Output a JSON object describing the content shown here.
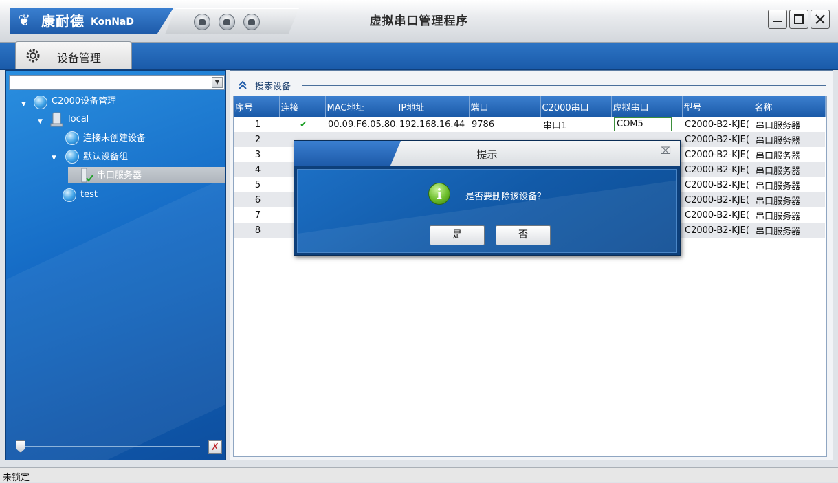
{
  "window": {
    "title": "虚拟串口管理程序",
    "logo_mark": "❦",
    "logo_cn": "康耐德",
    "logo_en": "KonNaD"
  },
  "tabs": [
    {
      "label": "设备管理",
      "icon": "gear-icon"
    }
  ],
  "sidebar": {
    "combo_value": "",
    "tree": [
      {
        "label": "C2000设备管理",
        "icon": "globe-icon",
        "expanded": true
      },
      {
        "label": "local",
        "icon": "server-icon",
        "expanded": true
      },
      {
        "label": "连接未创建设备",
        "icon": "globe-icon"
      },
      {
        "label": "默认设备组",
        "icon": "globe-icon",
        "expanded": true
      },
      {
        "label": "串口服务器",
        "icon": "device-check-icon",
        "selected": true
      },
      {
        "label": "test",
        "icon": "globe-icon"
      }
    ]
  },
  "search": {
    "label": "搜索设备"
  },
  "table": {
    "columns": [
      "序号",
      "连接",
      "MAC地址",
      "IP地址",
      "端口",
      "C2000串口",
      "虚拟串口",
      "型号",
      "名称"
    ],
    "rows": [
      {
        "no": "1",
        "conn": "✔",
        "mac": "00.09.F6.05.80.",
        "ip": "192.168.16.44",
        "port": "9786",
        "c2000": "串口1",
        "vport": "COM5",
        "model": "C2000-B2-KJE(",
        "name": "串口服务器"
      },
      {
        "no": "2",
        "conn": "",
        "mac": "",
        "ip": "",
        "port": "",
        "c2000": "",
        "vport": "",
        "model": "C2000-B2-KJE(",
        "name": "串口服务器"
      },
      {
        "no": "3",
        "conn": "",
        "mac": "",
        "ip": "",
        "port": "",
        "c2000": "",
        "vport": "",
        "model": "C2000-B2-KJE(",
        "name": "串口服务器"
      },
      {
        "no": "4",
        "conn": "",
        "mac": "",
        "ip": "",
        "port": "",
        "c2000": "",
        "vport": "",
        "model": "C2000-B2-KJE(",
        "name": "串口服务器"
      },
      {
        "no": "5",
        "conn": "",
        "mac": "",
        "ip": "",
        "port": "",
        "c2000": "",
        "vport": "",
        "model": "C2000-B2-KJE(",
        "name": "串口服务器"
      },
      {
        "no": "6",
        "conn": "",
        "mac": "",
        "ip": "",
        "port": "",
        "c2000": "",
        "vport": "",
        "model": "C2000-B2-KJE(",
        "name": "串口服务器"
      },
      {
        "no": "7",
        "conn": "",
        "mac": "",
        "ip": "",
        "port": "",
        "c2000": "",
        "vport": "",
        "model": "C2000-B2-KJE(",
        "name": "串口服务器"
      },
      {
        "no": "8",
        "conn": "",
        "mac": "",
        "ip": "",
        "port": "",
        "c2000": "",
        "vport": "",
        "model": "C2000-B2-KJE(",
        "name": "串口服务器"
      }
    ]
  },
  "dialog": {
    "title": "提示",
    "message": "是否要删除该设备？",
    "yes_label": "是",
    "no_label": "否",
    "icon": "info-icon",
    "min_glyph": "–",
    "close_glyph": "⌧"
  },
  "statusbar": {
    "text": "未锁定"
  },
  "colors": {
    "accent": "#1d5aa8",
    "panel": "#156bc5",
    "check": "#21a12a"
  }
}
